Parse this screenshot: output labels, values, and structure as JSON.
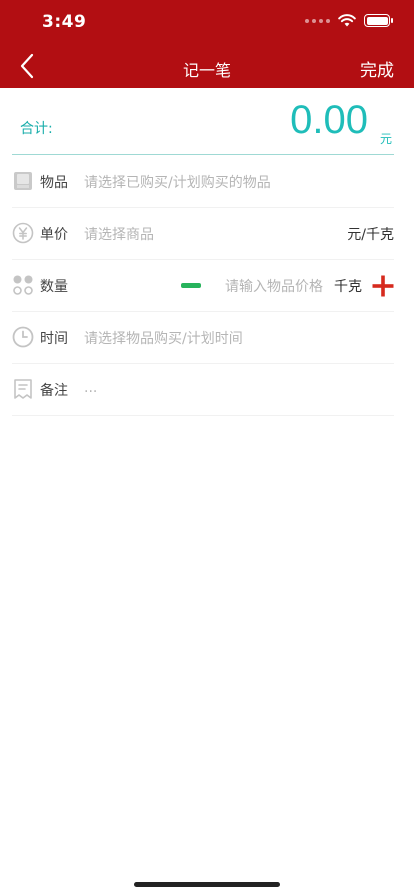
{
  "status_bar": {
    "time": "3:49"
  },
  "nav": {
    "title": "记一笔",
    "done_label": "完成"
  },
  "total": {
    "label": "合计:",
    "value": "0.00",
    "unit": "元"
  },
  "rows": {
    "item": {
      "label": "物品",
      "placeholder": "请选择已购买/计划购买的物品"
    },
    "price": {
      "label": "单价",
      "placeholder": "请选择商品",
      "unit": "元/千克"
    },
    "quantity": {
      "label": "数量",
      "placeholder": "请输入物品价格",
      "unit": "千克"
    },
    "time": {
      "label": "时间",
      "placeholder": "请选择物品购买/计划时间"
    },
    "note": {
      "label": "备注",
      "placeholder": "..."
    }
  },
  "colors": {
    "header": "#b20e12",
    "accent": "#1fbdb9",
    "minus": "#27b35c",
    "plus": "#d62a1e"
  }
}
